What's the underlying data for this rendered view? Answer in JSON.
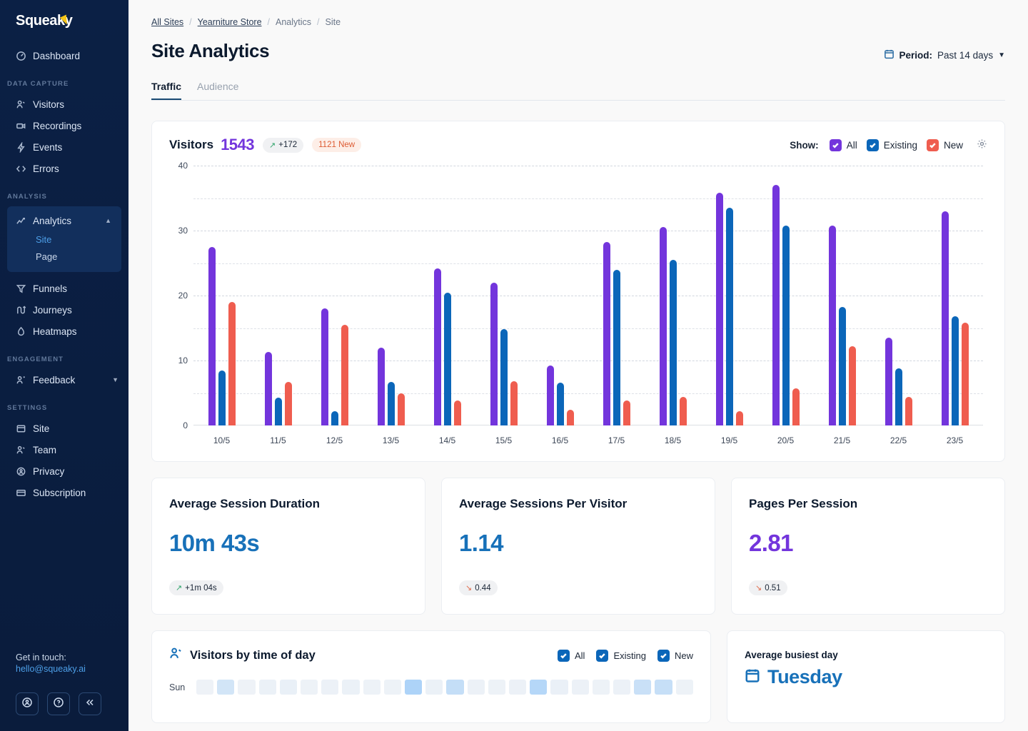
{
  "sidebar": {
    "brand": "Squeaky",
    "dashboard": {
      "label": "Dashboard",
      "icon": "dashboard-icon"
    },
    "sections": [
      {
        "label": "DATA CAPTURE",
        "items": [
          {
            "label": "Visitors",
            "icon": "visitors-icon"
          },
          {
            "label": "Recordings",
            "icon": "recordings-icon"
          },
          {
            "label": "Events",
            "icon": "events-icon"
          },
          {
            "label": "Errors",
            "icon": "errors-icon"
          }
        ]
      },
      {
        "label": "ANALYSIS",
        "items": [
          {
            "label": "Funnels",
            "icon": "funnels-icon"
          },
          {
            "label": "Journeys",
            "icon": "journeys-icon"
          },
          {
            "label": "Heatmaps",
            "icon": "heatmaps-icon"
          }
        ]
      },
      {
        "label": "ENGAGEMENT",
        "items": [
          {
            "label": "Feedback",
            "icon": "feedback-icon"
          }
        ]
      },
      {
        "label": "SETTINGS",
        "items": [
          {
            "label": "Site",
            "icon": "site-icon"
          },
          {
            "label": "Team",
            "icon": "team-icon"
          },
          {
            "label": "Privacy",
            "icon": "privacy-icon"
          },
          {
            "label": "Subscription",
            "icon": "subscription-icon"
          }
        ]
      }
    ],
    "analytics_group": {
      "label": "Analytics",
      "icon": "analytics-icon",
      "sub": [
        {
          "label": "Site",
          "active": true
        },
        {
          "label": "Page",
          "active": false
        }
      ]
    },
    "footer": {
      "get_in_touch": "Get in touch:",
      "email": "hello@squeaky.ai",
      "buttons": [
        "account-icon",
        "help-icon",
        "collapse-icon"
      ]
    }
  },
  "header": {
    "breadcrumb": [
      {
        "label": "All Sites",
        "link": true
      },
      {
        "label": "Yearniture Store",
        "link": true
      },
      {
        "label": "Analytics",
        "link": false
      },
      {
        "label": "Site",
        "link": false
      }
    ],
    "separator": "/",
    "title": "Site Analytics",
    "period_label": "Period:",
    "period_value": "Past 14 days",
    "tabs": [
      {
        "label": "Traffic",
        "active": true
      },
      {
        "label": "Audience",
        "active": false
      }
    ]
  },
  "visitors_card": {
    "title": "Visitors",
    "total": "1543",
    "delta": "+172",
    "delta_arrow": "↗",
    "new_badge": "1121 New",
    "show_label": "Show:",
    "legend": [
      {
        "label": "All",
        "color": "#7335dc",
        "checked": true
      },
      {
        "label": "Existing",
        "color": "#0b66b9",
        "checked": true
      },
      {
        "label": "New",
        "color": "#ef5d4f",
        "checked": true
      }
    ],
    "settings_icon": "gear-icon"
  },
  "chart_data": {
    "type": "bar",
    "title": "Visitors",
    "xlabel": "",
    "ylabel": "",
    "ylim": [
      0,
      40
    ],
    "yticks": [
      0,
      10,
      20,
      30,
      40
    ],
    "grid": true,
    "gridlines_minor": [
      5,
      15,
      25,
      35
    ],
    "legend_position": "top-right",
    "categories": [
      "10/5",
      "11/5",
      "12/5",
      "13/5",
      "14/5",
      "15/5",
      "16/5",
      "17/5",
      "18/5",
      "19/5",
      "20/5",
      "21/5",
      "22/5",
      "23/5"
    ],
    "series": [
      {
        "name": "All",
        "color": "#7335dc",
        "values": [
          27.5,
          11.3,
          18.0,
          12.0,
          24.2,
          22.0,
          9.2,
          28.2,
          30.5,
          35.8,
          37.0,
          30.8,
          13.5,
          33.0
        ]
      },
      {
        "name": "Existing",
        "color": "#0b66b9",
        "values": [
          8.5,
          4.3,
          2.2,
          6.7,
          20.4,
          14.8,
          6.6,
          24.0,
          25.5,
          33.5,
          30.8,
          18.2,
          8.8,
          16.8
        ]
      },
      {
        "name": "New",
        "color": "#ef5d4f",
        "values": [
          19.0,
          6.7,
          15.5,
          4.9,
          3.8,
          6.8,
          2.4,
          3.8,
          4.4,
          2.2,
          5.7,
          12.2,
          4.4,
          15.8
        ]
      }
    ]
  },
  "metrics": [
    {
      "title": "Average Session Duration",
      "value": "10m 43s",
      "color": "blue",
      "delta": "+1m 04s",
      "arrow": "↗",
      "direction": "up"
    },
    {
      "title": "Average Sessions Per Visitor",
      "value": "1.14",
      "color": "blue",
      "delta": "0.44",
      "arrow": "↘",
      "direction": "down"
    },
    {
      "title": "Pages Per Session",
      "value": "2.81",
      "color": "purple",
      "delta": "0.51",
      "arrow": "↘",
      "direction": "down"
    }
  ],
  "time_of_day": {
    "title": "Visitors by time of day",
    "icon": "visitors-icon",
    "legend": [
      {
        "label": "All",
        "checked": true
      },
      {
        "label": "Existing",
        "checked": true
      },
      {
        "label": "New",
        "checked": true
      }
    ],
    "rows": [
      {
        "day": "Sun",
        "values": [
          0.05,
          0.3,
          0.05,
          0.08,
          0.1,
          0.06,
          0.07,
          0.08,
          0.06,
          0.06,
          0.62,
          0.08,
          0.42,
          0.07,
          0.06,
          0.07,
          0.55,
          0.09,
          0.07,
          0.06,
          0.07,
          0.38,
          0.4,
          0.06
        ]
      }
    ]
  },
  "busiest": {
    "label": "Average busiest day",
    "value": "Tuesday",
    "icon": "calendar-icon"
  }
}
